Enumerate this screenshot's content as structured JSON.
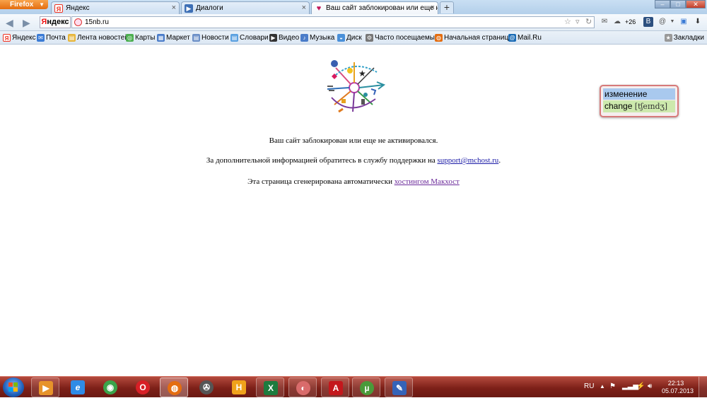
{
  "browser": {
    "menu_label": "Firefox",
    "tabs": [
      {
        "label": "Яндекс",
        "icon": "yandex-icon",
        "active": false
      },
      {
        "label": "Диалоги",
        "icon": "dialogs-icon",
        "active": false
      },
      {
        "label": "Ваш сайт заблокирован или еще не...",
        "icon": "heart-icon",
        "active": true
      }
    ],
    "url": "15nb.ru",
    "yandex_badge": {
      "first": "Я",
      "rest": "ндекс"
    },
    "weather": "+26",
    "bookmarks": [
      {
        "label": "Яндекс",
        "icon": "yandex-icon",
        "color": "#e32"
      },
      {
        "label": "Почта",
        "icon": "mail-icon",
        "color": "#3a7bd5"
      },
      {
        "label": "Лента новостей",
        "icon": "folder-icon",
        "color": "#e7b63b"
      },
      {
        "label": "Карты",
        "icon": "maps-icon",
        "color": "#4caf50"
      },
      {
        "label": "Маркет",
        "icon": "market-icon",
        "color": "#4a7cc9"
      },
      {
        "label": "Новости",
        "icon": "news-icon",
        "color": "#6b8fc7"
      },
      {
        "label": "Словари",
        "icon": "dictionary-icon",
        "color": "#5aa0e0"
      },
      {
        "label": "Видео",
        "icon": "video-icon",
        "color": "#333"
      },
      {
        "label": "Музыка",
        "icon": "music-icon",
        "color": "#4a7cc9"
      },
      {
        "label": "Диск",
        "icon": "disk-icon",
        "color": "#4a90d9"
      },
      {
        "label": "Часто посещаемые",
        "icon": "gear-icon",
        "color": "#777"
      },
      {
        "label": "Начальная страница",
        "icon": "firefox-icon",
        "color": "#e46d10"
      },
      {
        "label": "Mail.Ru",
        "icon": "mailru-icon",
        "color": "#1a6bb5"
      }
    ],
    "bookmarks_menu": "Закладки"
  },
  "page": {
    "line1": "Ваш сайт заблокирован или еще не активировался.",
    "line2_prefix": "За дополнительной информацией обратитесь в службу поддержки на ",
    "line2_link": "support@mchost.ru",
    "line2_suffix": ".",
    "line3_prefix": "Эта страница сгенерирована автоматически ",
    "line3_link": "хостингом Макхост"
  },
  "translator_popup": {
    "word_ru": "изменение",
    "word_en": "change",
    "transcription": "[tʃeɪndʒ]"
  },
  "taskbar": {
    "apps": [
      {
        "icon": "media-player-icon",
        "color": "#e7932a",
        "glyph": "▶"
      },
      {
        "icon": "internet-explorer-icon",
        "color": "#2f8be6",
        "glyph": "e"
      },
      {
        "icon": "chrome-icon",
        "color": "#3aa44a",
        "glyph": "◉"
      },
      {
        "icon": "opera-icon",
        "color": "#d81f26",
        "glyph": "O"
      },
      {
        "icon": "firefox-icon",
        "color": "#e46d10",
        "glyph": "◍"
      },
      {
        "icon": "video-editor-icon",
        "color": "#555",
        "glyph": "✇"
      },
      {
        "icon": "hotspot-icon",
        "color": "#f0a21b",
        "glyph": "H"
      },
      {
        "icon": "excel-icon",
        "color": "#1e7b3e",
        "glyph": "X"
      },
      {
        "icon": "opera-mail-icon",
        "color": "#d96b6b",
        "glyph": "◐"
      },
      {
        "icon": "acrobat-icon",
        "color": "#c4171c",
        "glyph": "A"
      },
      {
        "icon": "utorrent-icon",
        "color": "#4a9a3a",
        "glyph": "µ"
      },
      {
        "icon": "pen-tool-icon",
        "color": "#3563b8",
        "glyph": "✎"
      }
    ],
    "lang": "RU",
    "time": "22:13",
    "date": "05.07.2013"
  }
}
